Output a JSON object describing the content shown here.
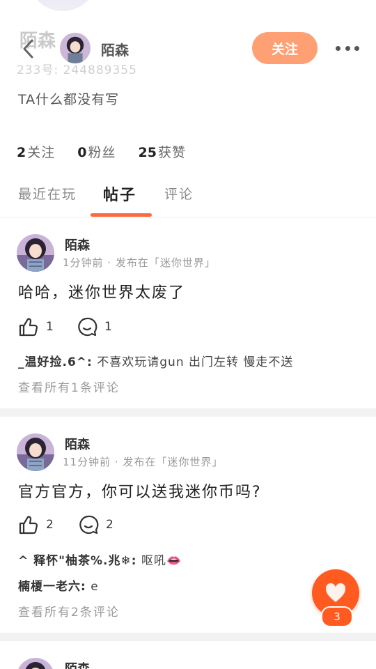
{
  "header": {
    "ghost_name": "陌森",
    "ghost_id": "233号: 244889355",
    "name": "陌森",
    "follow_label": "关注"
  },
  "profile": {
    "bio": "TA什么都没有写",
    "stats": [
      {
        "num": "2",
        "label": "关注"
      },
      {
        "num": "0",
        "label": "粉丝"
      },
      {
        "num": "25",
        "label": "获赞"
      }
    ]
  },
  "tabs": [
    {
      "label": "最近在玩"
    },
    {
      "label": "帖子"
    },
    {
      "label": "评论"
    }
  ],
  "posts": [
    {
      "author": "陌森",
      "meta": "1分钟前 · 发布在「迷你世界」",
      "content": "哈哈，迷你世界太废了",
      "likes": "1",
      "comments": "1",
      "comment_lines": [
        {
          "user": "_温好捡.6^:",
          "text": " 不喜欢玩请gun 出门左转 慢走不送"
        }
      ],
      "view_all": "查看所有1条评论"
    },
    {
      "author": "陌森",
      "meta": "11分钟前 · 发布在「迷你世界」",
      "content": "官方官方，你可以送我迷你币吗?",
      "likes": "2",
      "comments": "2",
      "comment_lines": [
        {
          "user": "^ 释怀\"柚茶%.兆❄:",
          "text": " 呕吼👄"
        },
        {
          "user": "楠榎一老六:",
          "text": " e"
        }
      ],
      "view_all": "查看所有2条评论"
    },
    {
      "author": "陌森"
    }
  ],
  "fab": {
    "count": "3"
  },
  "colors": {
    "accent": "#ff5a1f",
    "follow": "#ff9f73",
    "underline": "#ff6a3d"
  }
}
